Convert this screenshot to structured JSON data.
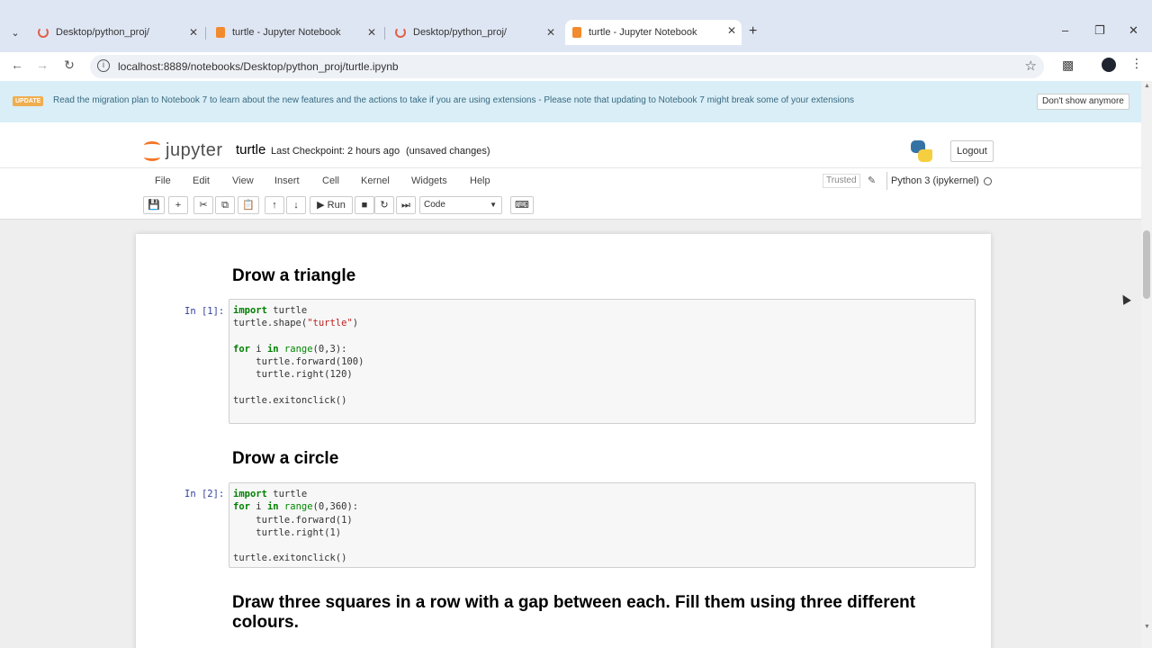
{
  "browser": {
    "tabs": [
      {
        "title": "Desktop/python_proj/",
        "favicon": "spinner-icon",
        "active": false
      },
      {
        "title": "turtle - Jupyter Notebook",
        "favicon": "notebook-icon",
        "active": false
      },
      {
        "title": "Desktop/python_proj/",
        "favicon": "spinner-icon",
        "active": false
      },
      {
        "title": "turtle - Jupyter Notebook",
        "favicon": "notebook-icon",
        "active": true
      }
    ],
    "url": "localhost:8889/notebooks/Desktop/python_proj/turtle.ipynb"
  },
  "banner": {
    "tag": "UPDATE",
    "message": "Read the migration plan to Notebook 7 to learn about the new features and the actions to take if you are using extensions - Please note that updating to Notebook 7 might break some of your extensions",
    "dismiss_label": "Don't show anymore"
  },
  "jupyter": {
    "logo_text": "jupyter",
    "notebook_name": "turtle",
    "checkpoint": "Last Checkpoint: 2 hours ago",
    "unsaved": "(unsaved changes)",
    "logout_label": "Logout",
    "menu": [
      "File",
      "Edit",
      "View",
      "Insert",
      "Cell",
      "Kernel",
      "Widgets",
      "Help"
    ],
    "trusted_label": "Trusted",
    "kernel_name": "Python 3 (ipykernel)",
    "run_label": "Run",
    "cell_type": "Code"
  },
  "notebook": {
    "heading1": "Drow a triangle",
    "prompt1": "In [1]:",
    "heading2": "Drow a circle",
    "prompt2": "In [2]:",
    "heading3": "Draw three squares in a row with a gap between each. Fill them using three different colours."
  },
  "colors": {
    "jupyter_orange": "#f37626",
    "banner_bg": "#d9eef7",
    "prompt_blue": "#303f9f",
    "keyword_green": "#008000",
    "string_red": "#ba2121"
  }
}
